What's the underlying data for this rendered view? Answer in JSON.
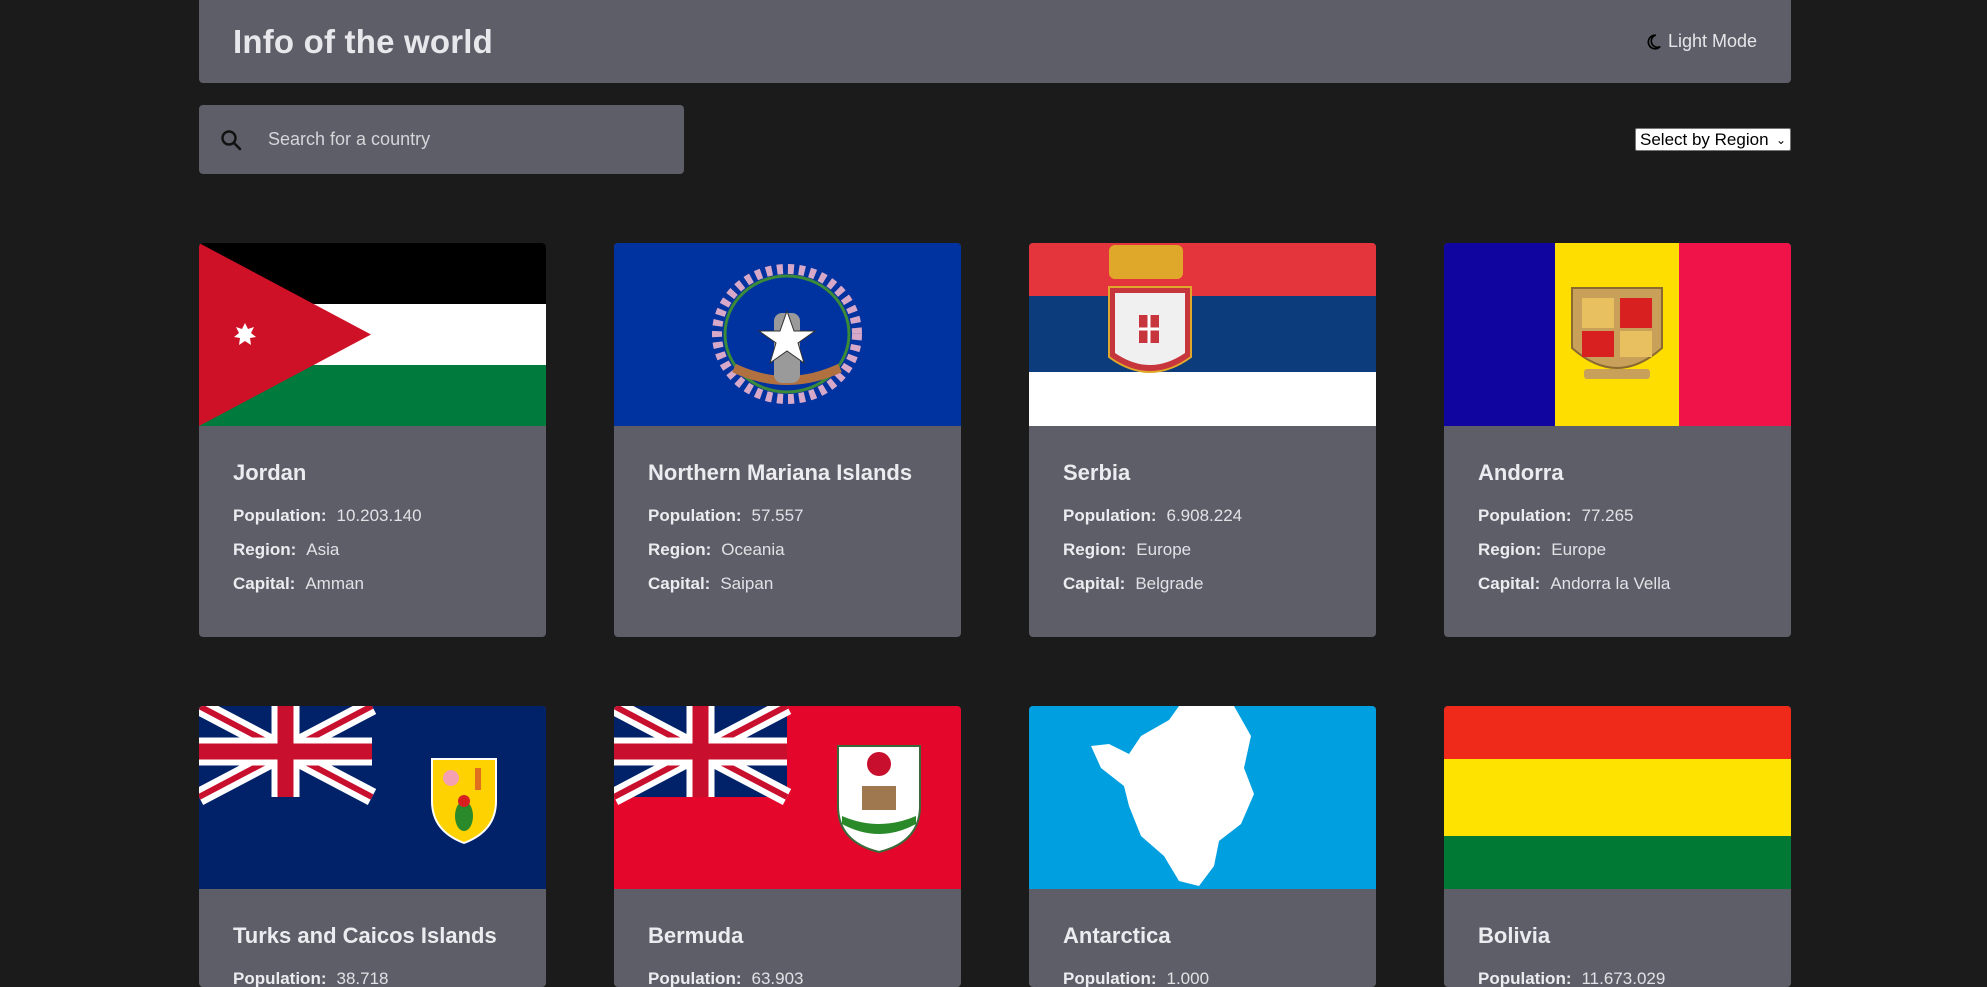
{
  "header": {
    "title": "Info of the world",
    "mode_label": "Light Mode"
  },
  "search": {
    "placeholder": "Search for a country"
  },
  "filter": {
    "selected": "Select by Region"
  },
  "labels": {
    "population": "Population:",
    "region": "Region:",
    "capital": "Capital:"
  },
  "countries": [
    {
      "name": "Jordan",
      "population": "10.203.140",
      "region": "Asia",
      "capital": "Amman",
      "flag": "jordan-flag"
    },
    {
      "name": "Northern Mariana Islands",
      "population": "57.557",
      "region": "Oceania",
      "capital": "Saipan",
      "flag": "northern-mariana-islands-flag"
    },
    {
      "name": "Serbia",
      "population": "6.908.224",
      "region": "Europe",
      "capital": "Belgrade",
      "flag": "serbia-flag"
    },
    {
      "name": "Andorra",
      "population": "77.265",
      "region": "Europe",
      "capital": "Andorra la Vella",
      "flag": "andorra-flag"
    },
    {
      "name": "Turks and Caicos Islands",
      "population": "38.718",
      "region": "",
      "capital": "",
      "flag": "turks-and-caicos-flag"
    },
    {
      "name": "Bermuda",
      "population": "63.903",
      "region": "",
      "capital": "",
      "flag": "bermuda-flag"
    },
    {
      "name": "Antarctica",
      "population": "1.000",
      "region": "",
      "capital": "",
      "flag": "antarctica-flag"
    },
    {
      "name": "Bolivia",
      "population": "11.673.029",
      "region": "",
      "capital": "",
      "flag": "bolivia-flag"
    }
  ],
  "colors": {
    "background": "#1b1b1b",
    "element": "#5d5e67",
    "text": "#e6e6e6"
  }
}
